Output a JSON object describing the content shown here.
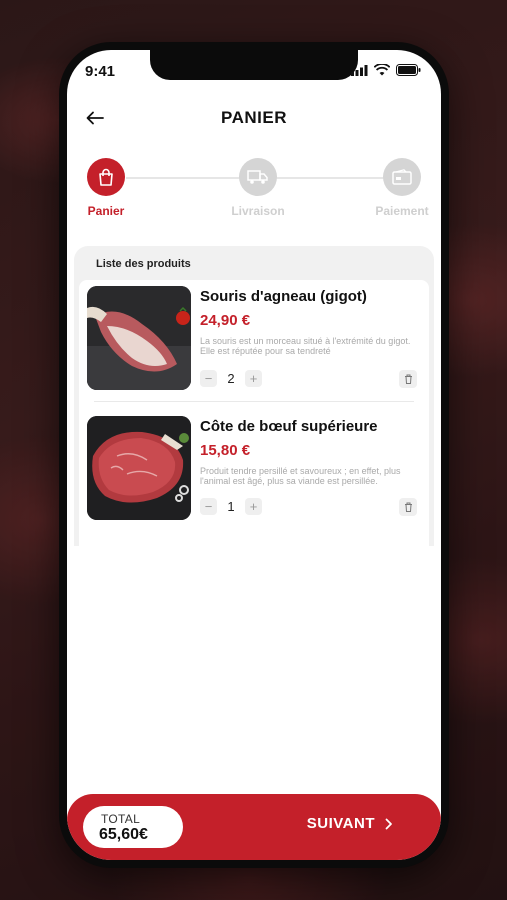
{
  "status_bar": {
    "time": "9:41"
  },
  "header": {
    "title": "PANIER"
  },
  "steps": [
    {
      "label": "Panier",
      "state": "active",
      "icon": "bag-icon"
    },
    {
      "label": "Livraison",
      "state": "inactive",
      "icon": "truck-icon"
    },
    {
      "label": "Paiement",
      "state": "inactive",
      "icon": "card-icon"
    }
  ],
  "cart": {
    "title": "Liste des produits",
    "products": [
      {
        "name": "Souris d'agneau (gigot)",
        "price": "24,90 €",
        "description": "La souris est un morceau situé à l'extrémité du gigot. Elle est réputée pour sa tendreté",
        "quantity": "2",
        "minus": "−",
        "plus": "+"
      },
      {
        "name": "Côte de bœuf supérieure",
        "price": "15,80 €",
        "description": "Produit tendre persillé et savoureux ; en effet, plus l'animal est âgé, plus sa viande est persillée.",
        "quantity": "1",
        "minus": "−",
        "plus": "+"
      }
    ]
  },
  "footer": {
    "total_label": "TOTAL",
    "total_value": "65,60€",
    "next_label": "SUIVANT"
  },
  "colors": {
    "accent": "#c4202a",
    "inactive": "#d5d5d5"
  }
}
